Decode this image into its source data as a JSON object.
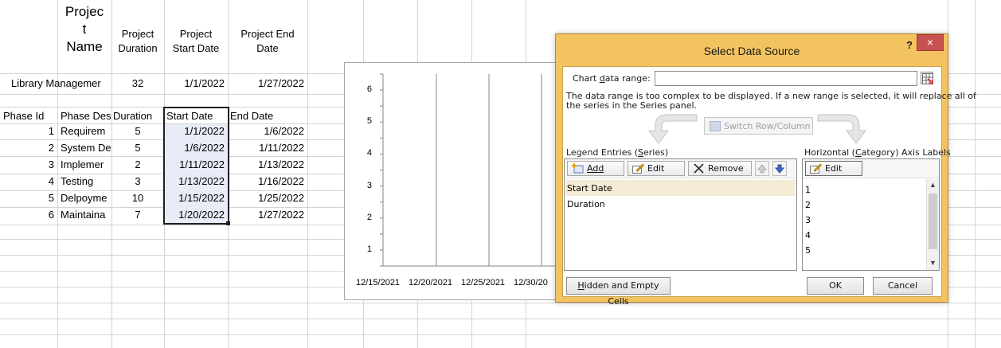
{
  "sheet": {
    "header": {
      "project_name": [
        "Projec",
        "t",
        "Name"
      ],
      "project_duration": [
        "Project",
        "Duration"
      ],
      "project_start_date": [
        "Project",
        "Start Date"
      ],
      "project_end_date": [
        "Project End",
        "Date"
      ]
    },
    "project_row": {
      "name": "Library Managemer",
      "duration": "32",
      "start": "1/1/2022",
      "end": "1/27/2022"
    },
    "phase_headers": [
      "Phase Id",
      "Phase Des",
      "Duration",
      "Start Date",
      "End Date"
    ],
    "phases": [
      {
        "id": "1",
        "desc": "Requirem",
        "duration": "5",
        "start": "1/1/2022",
        "end": "1/6/2022"
      },
      {
        "id": "2",
        "desc": "System De",
        "duration": "5",
        "start": "1/6/2022",
        "end": "1/11/2022"
      },
      {
        "id": "3",
        "desc": "Implemer",
        "duration": "2",
        "start": "1/11/2022",
        "end": "1/13/2022"
      },
      {
        "id": "4",
        "desc": "Testing",
        "duration": "3",
        "start": "1/13/2022",
        "end": "1/16/2022"
      },
      {
        "id": "5",
        "desc": "Delpoyme",
        "duration": "10",
        "start": "1/15/2022",
        "end": "1/25/2022"
      },
      {
        "id": "6",
        "desc": "Maintaina",
        "duration": "7",
        "start": "1/20/2022",
        "end": "1/27/2022"
      }
    ]
  },
  "chart_data": {
    "type": "bar",
    "title": "",
    "y_ticks": [
      "6",
      "5",
      "4",
      "3",
      "2",
      "1"
    ],
    "x_ticks": [
      "12/15/2021",
      "12/20/2021",
      "12/25/2021",
      "12/30/20"
    ],
    "grid": true
  },
  "dialog": {
    "title": "Select Data Source",
    "help": "?",
    "close": "×",
    "chart_range_label": "Chart data range:",
    "chart_range_value": "",
    "message_line1": "The data range is too complex to be displayed. If a new range is selected, it will replace all of",
    "message_line2": "the series in the Series panel.",
    "switch_label": "Switch Row/Column",
    "legend_label": "Legend Entries (Series)",
    "axis_label": "Horizontal (Category) Axis Labels",
    "add_label": "Add",
    "edit_label": "Edit",
    "remove_label": "Remove",
    "axis_edit_label": "Edit",
    "series": [
      "Start Date",
      "Duration"
    ],
    "axis_labels": [
      "1",
      "2",
      "3",
      "4",
      "5"
    ],
    "hidden_empty_label": "Hidden and Empty Cells",
    "ok_label": "OK",
    "cancel_label": "Cancel"
  }
}
